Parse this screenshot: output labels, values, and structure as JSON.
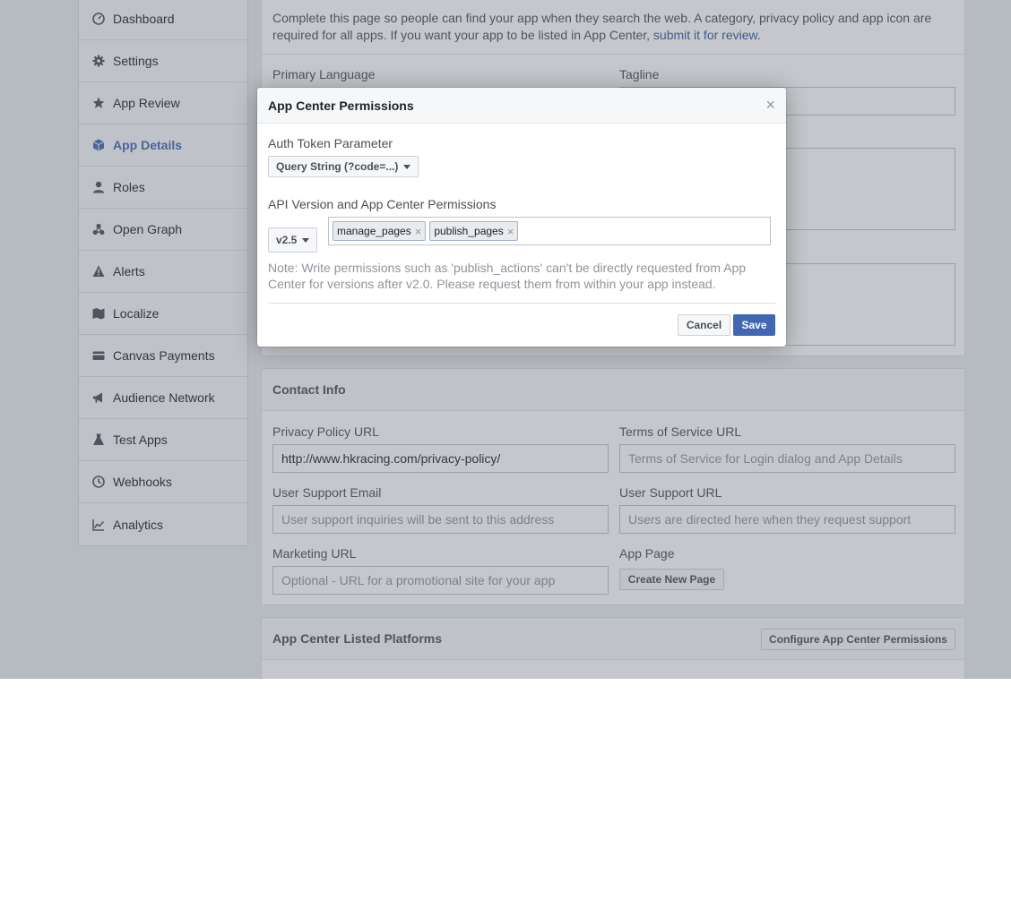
{
  "sidebar": {
    "items": [
      {
        "label": "Dashboard",
        "icon": "dashboard-icon"
      },
      {
        "label": "Settings",
        "icon": "gear-icon"
      },
      {
        "label": "App Review",
        "icon": "star-icon"
      },
      {
        "label": "App Details",
        "icon": "cube-icon",
        "active": true
      },
      {
        "label": "Roles",
        "icon": "person-icon"
      },
      {
        "label": "Open Graph",
        "icon": "graph-icon"
      },
      {
        "label": "Alerts",
        "icon": "warning-icon"
      },
      {
        "label": "Localize",
        "icon": "map-icon"
      },
      {
        "label": "Canvas Payments",
        "icon": "card-icon"
      },
      {
        "label": "Audience Network",
        "icon": "megaphone-icon"
      },
      {
        "label": "Test Apps",
        "icon": "flask-icon"
      },
      {
        "label": "Webhooks",
        "icon": "clock-icon"
      },
      {
        "label": "Analytics",
        "icon": "chart-icon"
      }
    ]
  },
  "details": {
    "intro_text": "Complete this page so people can find your app when they search the web. A category, privacy policy and app icon are required for all apps. If you want your app to be listed in App Center, ",
    "intro_link": "submit it for review",
    "intro_end": ".",
    "primary_language_label": "Primary Language",
    "tagline_label": "Tagline"
  },
  "contact": {
    "header": "Contact Info",
    "privacy_label": "Privacy Policy URL",
    "privacy_value": "http://www.hkracing.com/privacy-policy/",
    "tos_label": "Terms of Service URL",
    "tos_placeholder": "Terms of Service for Login dialog and App Details",
    "support_email_label": "User Support Email",
    "support_email_placeholder": "User support inquiries will be sent to this address",
    "support_url_label": "User Support URL",
    "support_url_placeholder": "Users are directed here when they request support",
    "marketing_label": "Marketing URL",
    "marketing_placeholder": "Optional - URL for a promotional site for your app",
    "app_page_label": "App Page",
    "create_page_button": "Create New Page"
  },
  "platforms": {
    "header": "App Center Listed Platforms",
    "configure_button": "Configure App Center Permissions"
  },
  "dialog": {
    "title": "App Center Permissions",
    "close": "×",
    "auth_label": "Auth Token Parameter",
    "auth_value": "Query String (?code=...)",
    "api_label": "API Version and App Center Permissions",
    "api_version": "v2.5",
    "tokens": [
      "manage_pages",
      "publish_pages"
    ],
    "token_remove": "×",
    "note": "Note: Write permissions such as 'publish_actions' can't be directly requested from App Center for versions after v2.0. Please request them from within your app instead.",
    "cancel_label": "Cancel",
    "save_label": "Save"
  },
  "colors": {
    "accent": "#4267b2",
    "link": "#365899",
    "overlay": "#5a5f6e"
  }
}
